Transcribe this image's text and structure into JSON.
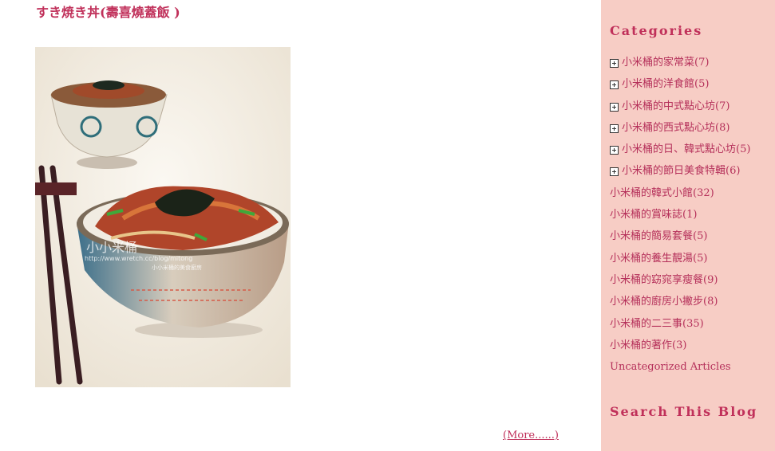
{
  "post": {
    "title": "すき焼き丼(壽喜燒蓋飯 )",
    "photo_watermark": "小小米桶",
    "photo_url_text": "http://www.wretch.cc/blog/mitong",
    "photo_caption_text": "小小米桶的美食廚房",
    "more_link": "(More......)"
  },
  "sidebar": {
    "categories_heading": "Categories",
    "search_heading": "Search This Blog",
    "categories": [
      {
        "label": "小米桶的家常菜(7)",
        "expandable": true
      },
      {
        "label": "小米桶的洋食館(5)",
        "expandable": true
      },
      {
        "label": "小米桶的中式點心坊(7)",
        "expandable": true
      },
      {
        "label": "小米桶的西式點心坊(8)",
        "expandable": true
      },
      {
        "label": "小米桶的日、韓式點心坊(5)",
        "expandable": true
      },
      {
        "label": "小米桶的節日美食特輯(6)",
        "expandable": true
      },
      {
        "label": "小米桶的韓式小館(32)",
        "expandable": false
      },
      {
        "label": "小米桶的賞味誌(1)",
        "expandable": false
      },
      {
        "label": "小米桶的簡易套餐(5)",
        "expandable": false
      },
      {
        "label": "小米桶的養生靚湯(5)",
        "expandable": false
      },
      {
        "label": "小米桶的窈窕享瘦餐(9)",
        "expandable": false
      },
      {
        "label": "小米桶的廚房小撇步(8)",
        "expandable": false
      },
      {
        "label": "小米桶的二三事(35)",
        "expandable": false
      },
      {
        "label": "小米桶的著作(3)",
        "expandable": false
      },
      {
        "label": "Uncategorized Articles",
        "expandable": false
      }
    ]
  },
  "colors": {
    "accent": "#c0305a",
    "sidebar_bg": "#f7cdc5"
  }
}
